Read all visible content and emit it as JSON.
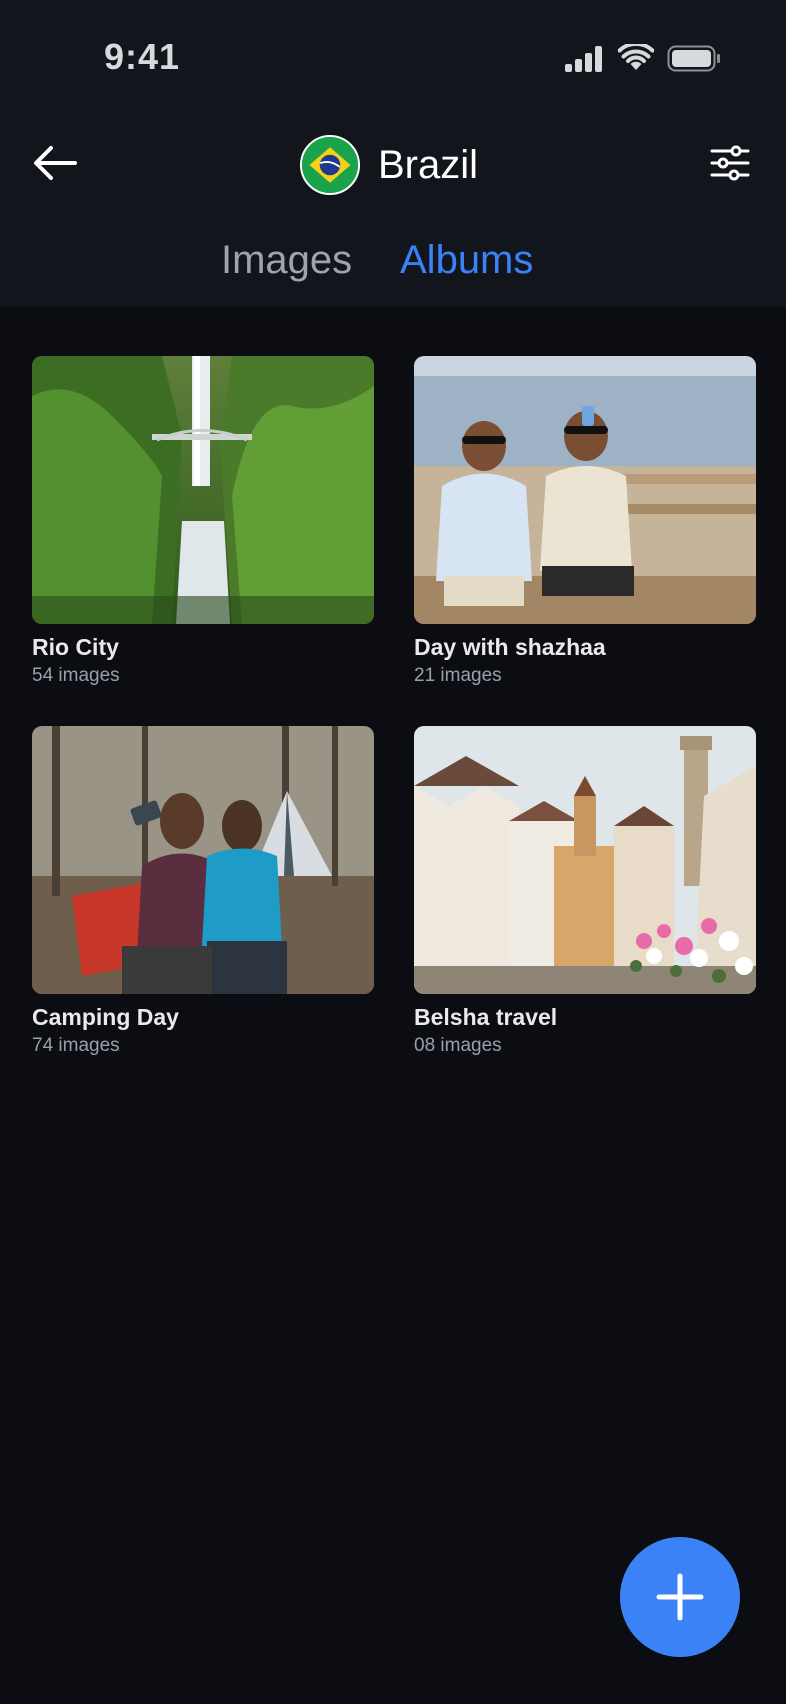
{
  "status_bar": {
    "time": "9:41"
  },
  "nav": {
    "title": "Brazil"
  },
  "tabs": [
    {
      "label": "Images"
    },
    {
      "label": "Albums",
      "active": true
    }
  ],
  "albums": [
    {
      "title": "Rio City",
      "count": "54 images"
    },
    {
      "title": "Day with shazhaa",
      "count": "21 images"
    },
    {
      "title": "Camping Day",
      "count": "74 images"
    },
    {
      "title": "Belsha travel",
      "count": "08 images"
    }
  ],
  "colors": {
    "accent": "#3b82f6",
    "background": "#0b0d12",
    "header": "#12151b"
  },
  "icons": [
    "signal-icon",
    "wifi-icon",
    "battery-icon",
    "back-arrow-icon",
    "brazil-flag-icon",
    "filter-sliders-icon",
    "plus-icon"
  ]
}
